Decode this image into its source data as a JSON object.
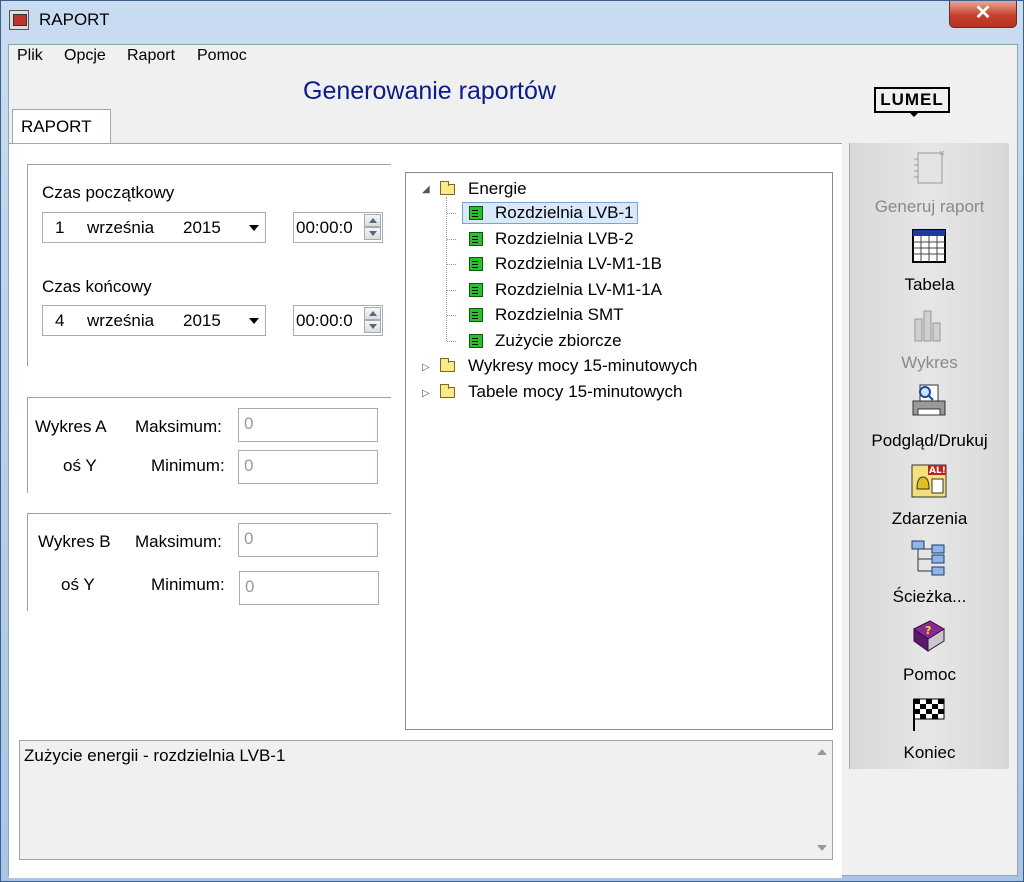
{
  "window": {
    "title": "RAPORT",
    "close_glyph": "✕"
  },
  "menu": [
    "Plik",
    "Opcje",
    "Raport",
    "Pomoc"
  ],
  "heading": "Generowanie raportów",
  "logo": "LUMEL",
  "tab": "RAPORT",
  "start": {
    "label": "Czas początkowy",
    "day": "1",
    "month": "września",
    "year": "2015",
    "time": "00:00:0"
  },
  "end": {
    "label": "Czas końcowy",
    "day": "4",
    "month": "września",
    "year": "2015",
    "time": "00:00:0"
  },
  "chart_a": {
    "label1": "Wykres A",
    "label2": "oś Y",
    "max_label": "Maksimum:",
    "min_label": "Minimum:",
    "max_value": "0",
    "min_value": "0"
  },
  "chart_b": {
    "label1": "Wykres B",
    "label2": "oś Y",
    "max_label": "Maksimum:",
    "min_label": "Minimum:",
    "max_value": "0",
    "min_value": "0"
  },
  "tree": {
    "root1": "Energie",
    "children": [
      "Rozdzielnia LVB-1",
      "Rozdzielnia LVB-2",
      "Rozdzielnia LV-M1-1B",
      "Rozdzielnia LV-M1-1A",
      "Rozdzielnia SMT",
      "Zużycie zbiorcze"
    ],
    "selected_index": 0,
    "root2": "Wykresy mocy 15-minutowych",
    "root3": "Tabele mocy 15-minutowych"
  },
  "status_text": "Zużycie energii - rozdzielnia LVB-1",
  "sidebar": [
    {
      "label": "Generuj raport",
      "icon": "notebook-icon",
      "enabled": false
    },
    {
      "label": "Tabela",
      "icon": "table-icon",
      "enabled": true
    },
    {
      "label": "Wykres",
      "icon": "chart-icon",
      "enabled": false
    },
    {
      "label": "Podgląd/Drukuj",
      "icon": "printer-icon",
      "enabled": true
    },
    {
      "label": "Zdarzenia",
      "icon": "alarm-icon",
      "enabled": true
    },
    {
      "label": "Ścieżka...",
      "icon": "folder-tree-icon",
      "enabled": true
    },
    {
      "label": "Pomoc",
      "icon": "help-book-icon",
      "enabled": true
    },
    {
      "label": "Koniec",
      "icon": "checkered-flag-icon",
      "enabled": true
    }
  ],
  "colors": {
    "heading": "#0c1a8c",
    "selection": "#d9e8fb",
    "tree_doc": "#2bbf2b"
  }
}
